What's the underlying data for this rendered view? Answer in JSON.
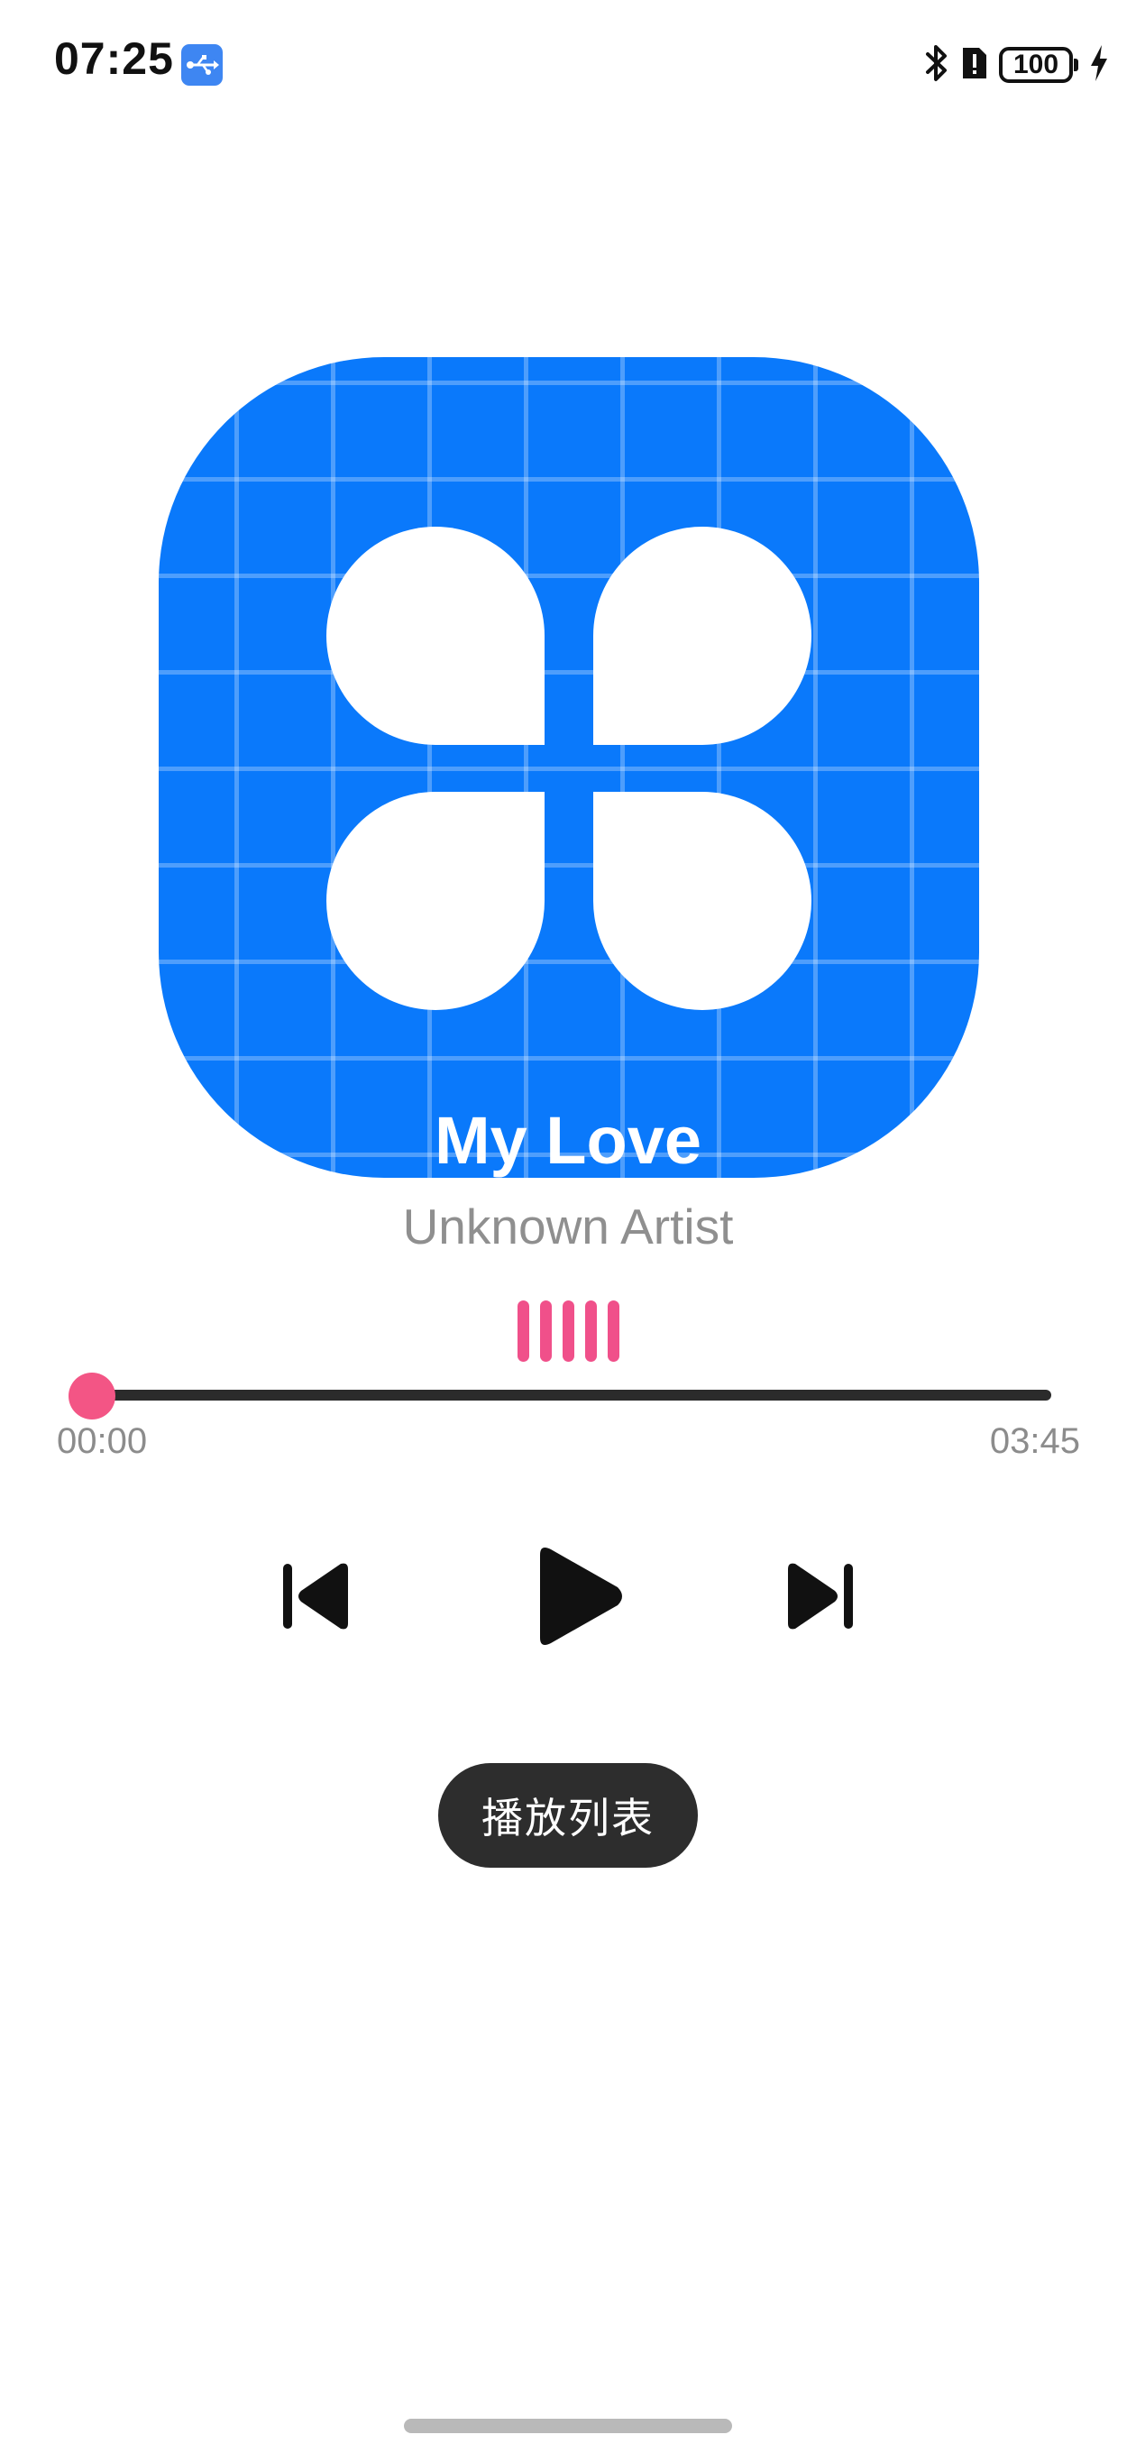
{
  "status_bar": {
    "time": "07:25",
    "battery_level": "100",
    "icons": [
      "usb-icon",
      "bluetooth-icon",
      "sim-alert-icon",
      "battery-icon",
      "charging-icon"
    ]
  },
  "album": {
    "icon": "clover-app-icon",
    "accent_color": "#0a79fb"
  },
  "track": {
    "title": "My Love",
    "artist": "Unknown Artist"
  },
  "equalizer": {
    "icon": "equalizer-icon",
    "color": "#f0508a"
  },
  "progress": {
    "current_time": "00:00",
    "total_time": "03:45",
    "fraction": 0.0,
    "color": "#f35585"
  },
  "controls": {
    "previous_icon": "skip-previous-icon",
    "play_icon": "play-icon",
    "next_icon": "skip-next-icon"
  },
  "playlist": {
    "label": "播放列表"
  }
}
